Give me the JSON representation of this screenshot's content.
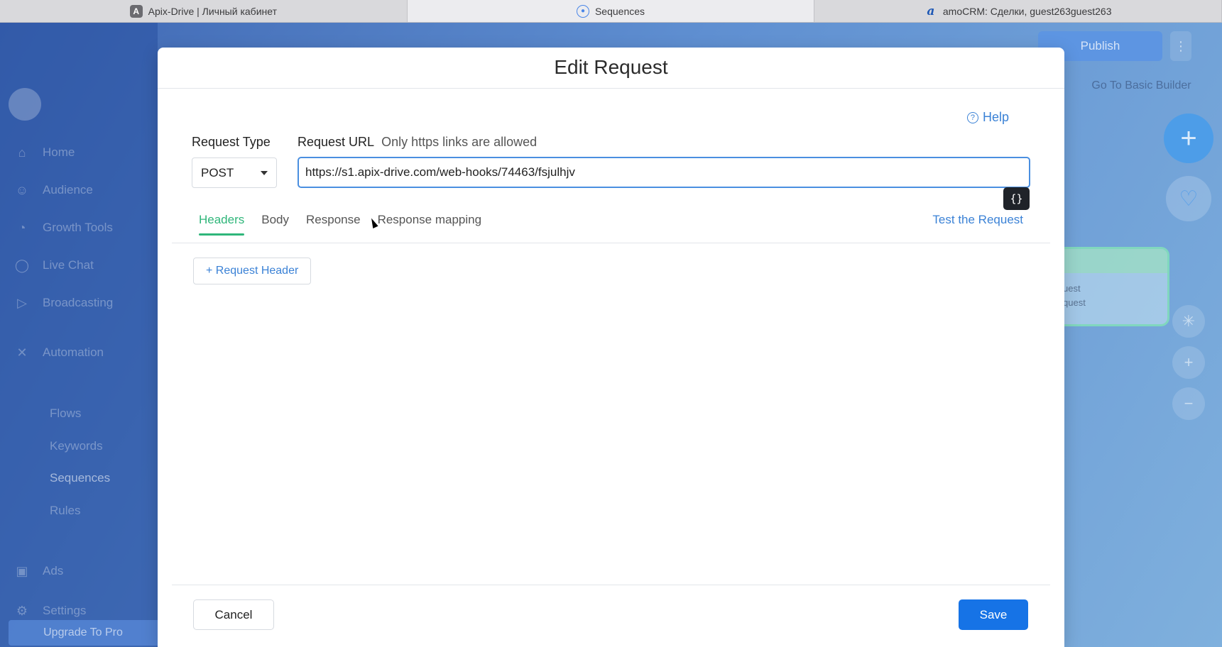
{
  "browser_tabs": [
    {
      "label": "Apix-Drive | Личный кабинет",
      "icon": "apix-drive-favicon",
      "active": false
    },
    {
      "label": "Sequences",
      "icon": "sequences-favicon",
      "active": true
    },
    {
      "label": "amoCRM: Сделки, guest263guest263",
      "icon": "amocrm-favicon",
      "active": false
    }
  ],
  "background": {
    "sidebar": {
      "items": [
        {
          "label": "Home",
          "icon": "home-icon"
        },
        {
          "label": "Audience",
          "icon": "user-icon"
        },
        {
          "label": "Growth Tools",
          "icon": "growth-icon"
        },
        {
          "label": "Live Chat",
          "icon": "chat-icon"
        },
        {
          "label": "Broadcasting",
          "icon": "send-icon"
        },
        {
          "label": "Automation",
          "icon": "automation-icon"
        },
        {
          "label": "Ads",
          "icon": "ads-icon"
        },
        {
          "label": "Settings",
          "icon": "settings-icon"
        }
      ],
      "sub_items": [
        "Flows",
        "Keywords",
        "Sequences",
        "Rules"
      ],
      "upgrade_label": "Upgrade To Pro"
    },
    "header": {
      "publish_label": "Publish",
      "basic_builder_label": "Go To Basic Builder"
    },
    "node_lines": [
      "uest",
      "quest"
    ]
  },
  "modal": {
    "title": "Edit Request",
    "help_label": "Help",
    "request_type_label": "Request Type",
    "request_type_value": "POST",
    "request_url_label": "Request URL",
    "request_url_hint": "Only https links are allowed",
    "request_url_value": "https://s1.apix-drive.com/web-hooks/74463/fsjulhjv",
    "var_button_label": "{}",
    "tabs": [
      "Headers",
      "Body",
      "Response",
      "Response mapping"
    ],
    "active_tab": "Headers",
    "test_request_label": "Test the Request",
    "add_header_label": "+ Request Header",
    "cancel_label": "Cancel",
    "save_label": "Save"
  },
  "colors": {
    "accent_blue": "#1673e6",
    "active_tab_green": "#2fb67a",
    "link_blue": "#3b82d6"
  }
}
